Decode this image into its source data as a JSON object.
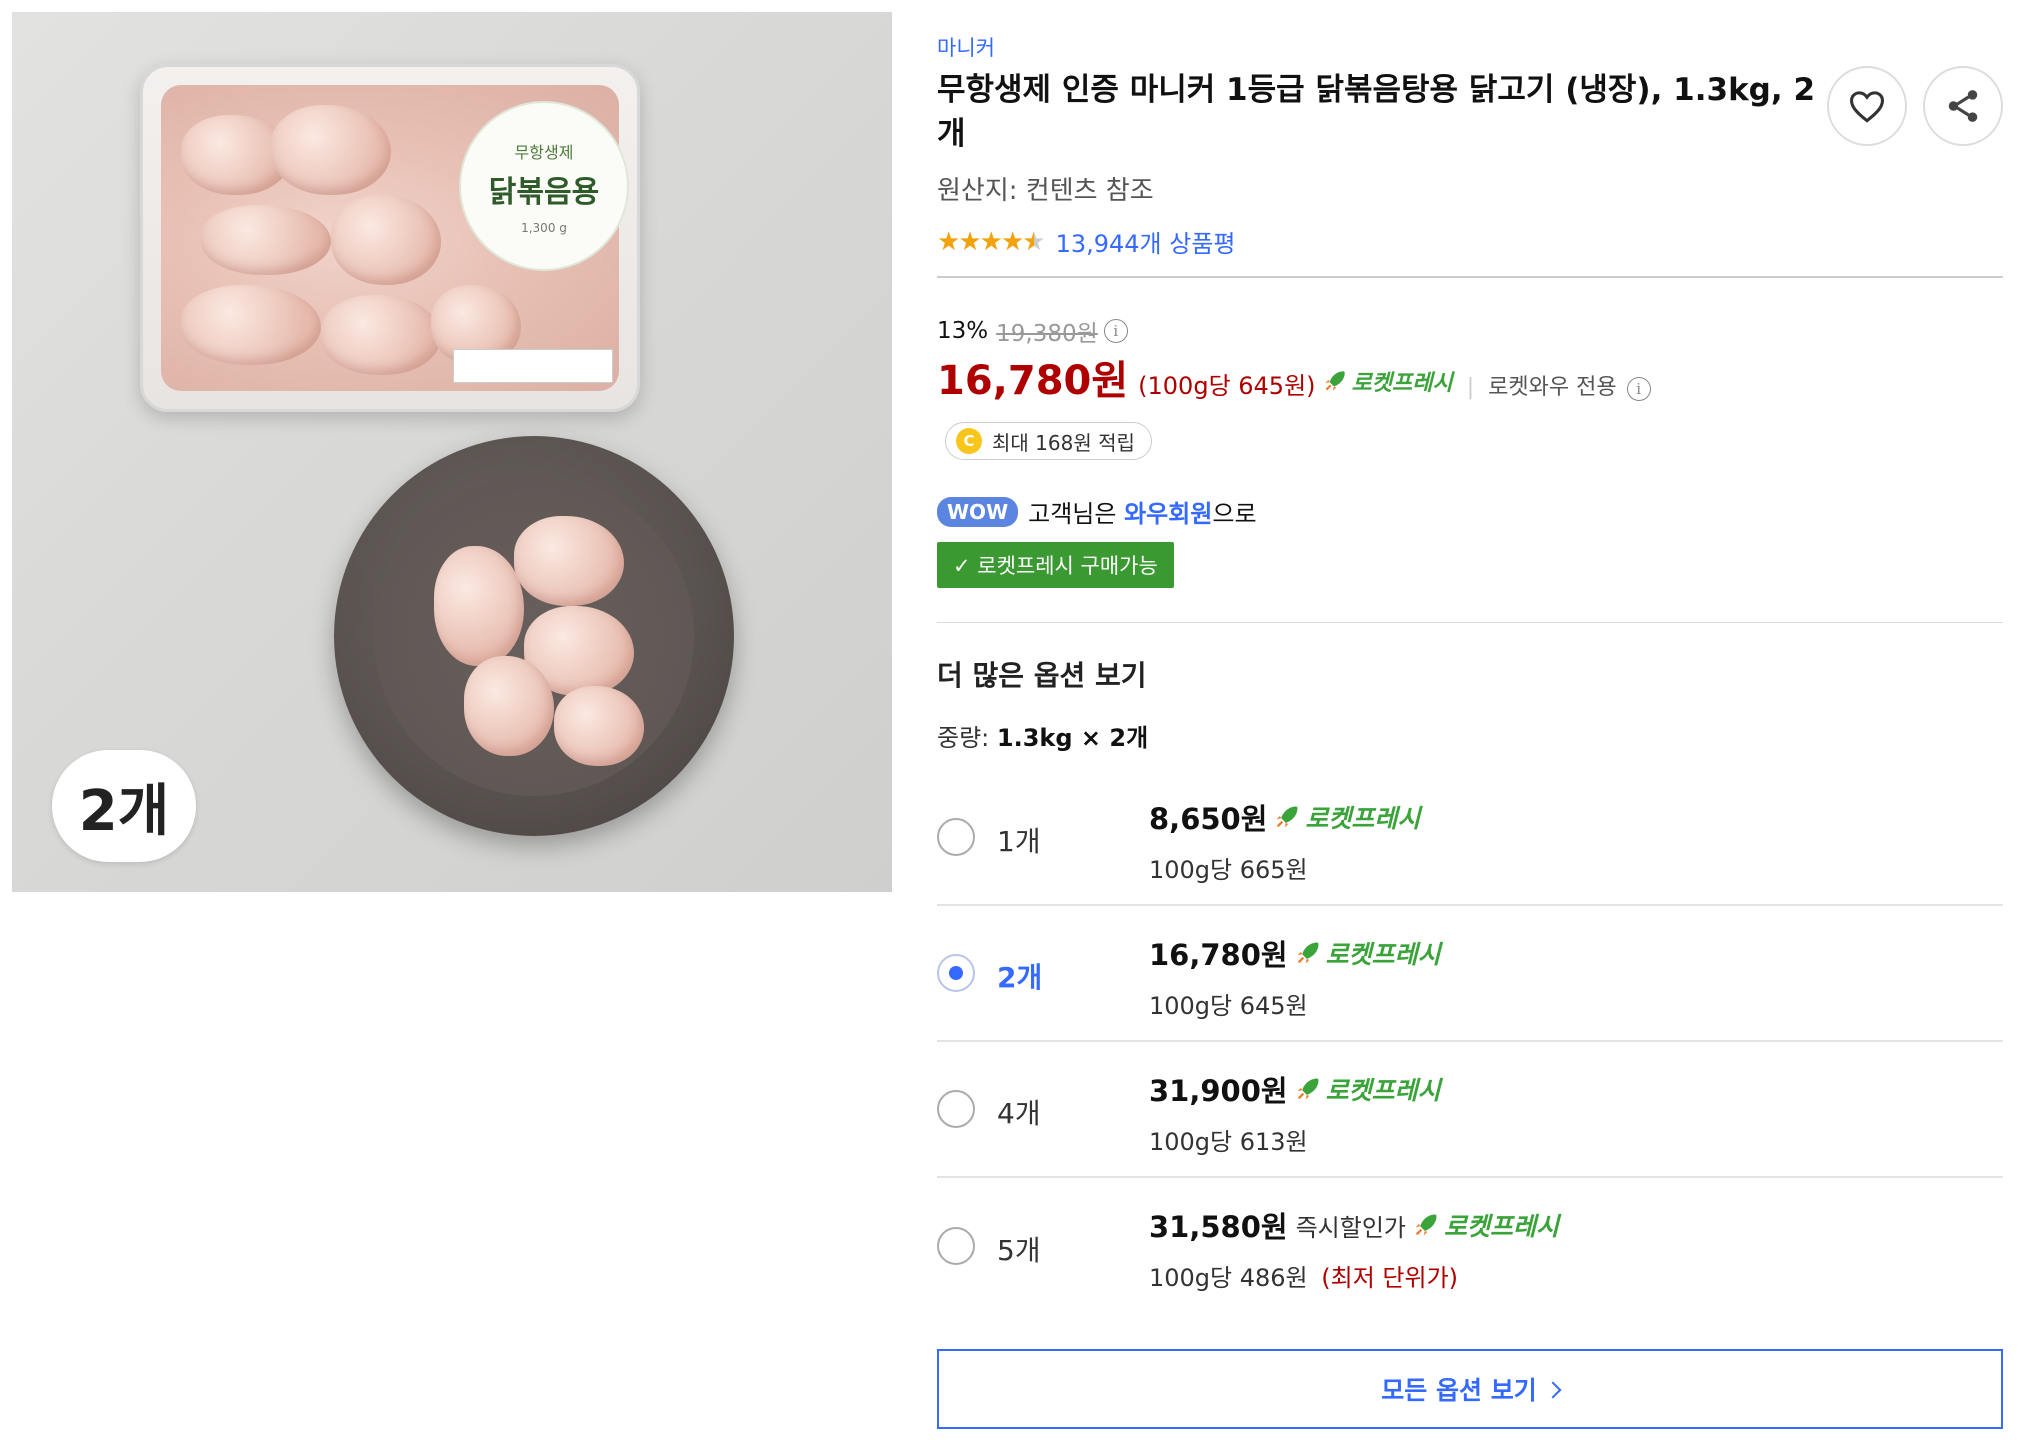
{
  "gallery": {
    "package_label_top": "무항생제",
    "package_label_main": "닭볶음용",
    "package_weight": "1,300 g",
    "count_badge": "2개"
  },
  "product": {
    "brand": "마니커",
    "title": "무항생제 인증 마니커 1등급 닭볶음탕용 닭고기 (냉장), 1.3kg, 2개",
    "origin": "원산지: 컨텐츠 참조",
    "rating_stars": 4.5,
    "review_count": "13,944개 상품평"
  },
  "pricing": {
    "discount_pct": "13%",
    "original_price": "19,380원",
    "sale_price": "16,780원",
    "unit_price": "(100g당 645원)",
    "rocket_label": "로켓프레시",
    "separator": "|",
    "wow_only": "로켓와우 전용",
    "reward": "최대 168원 적립",
    "coin_symbol": "C"
  },
  "membership": {
    "wow_badge": "WOW",
    "text_before": "고객님은 ",
    "wow_member": "와우회원",
    "text_after": "으로",
    "fresh_badge": "✓ 로켓프레시 구매가능"
  },
  "options": {
    "section_title": "더 많은 옵션 보기",
    "weight_label": "중량:",
    "weight_value": "1.3kg × 2개",
    "items": [
      {
        "count": "1개",
        "price": "8,650원",
        "tag": "",
        "unit": "100g당 665원",
        "note": "",
        "selected": false
      },
      {
        "count": "2개",
        "price": "16,780원",
        "tag": "",
        "unit": "100g당 645원",
        "note": "",
        "selected": true
      },
      {
        "count": "4개",
        "price": "31,900원",
        "tag": "",
        "unit": "100g당 613원",
        "note": "",
        "selected": false
      },
      {
        "count": "5개",
        "price": "31,580원",
        "tag": "즉시할인가",
        "unit": "100g당 486원",
        "note": "(최저 단위가)",
        "selected": false
      }
    ],
    "all_options_label": "모든 옵션 보기"
  },
  "colors": {
    "accent_blue": "#346aff",
    "price_red": "#ae0000",
    "rocket_green": "#3aa339",
    "star": "#f2a20c"
  },
  "icons": [
    "heart-icon",
    "share-icon",
    "star-icon",
    "info-icon",
    "rocket-icon",
    "coin-icon",
    "check-icon",
    "chevron-right-icon"
  ]
}
